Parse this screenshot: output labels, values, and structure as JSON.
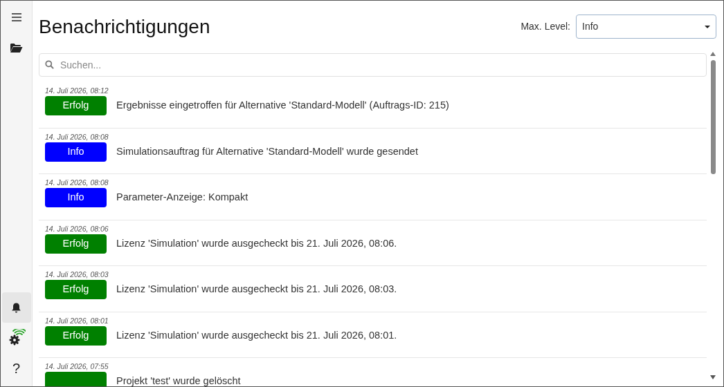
{
  "sidebar": {
    "items": [
      {
        "kind": "menu",
        "selected": false
      },
      {
        "kind": "folder",
        "selected": false
      }
    ],
    "bottom_items": [
      {
        "kind": "bell",
        "selected": true
      },
      {
        "kind": "settings-connected",
        "selected": false
      },
      {
        "kind": "help",
        "selected": false,
        "label": "?"
      }
    ]
  },
  "title": "Benachrichtigungen",
  "filter": {
    "label": "Max. Level:",
    "value": "Info"
  },
  "search": {
    "placeholder": "Suchen..."
  },
  "notifications": [
    {
      "time": "14. Juli 2026, 08:12",
      "kind": "success",
      "badge": "Erfolg",
      "message": "Ergebnisse eingetroffen für Alternative 'Standard-Modell' (Auftrags-ID: 215)"
    },
    {
      "time": "14. Juli 2026, 08:08",
      "kind": "info",
      "badge": "Info",
      "message": "Simulationsauftrag für Alternative 'Standard-Modell' wurde gesendet"
    },
    {
      "time": "14. Juli 2026, 08:08",
      "kind": "info",
      "badge": "Info",
      "message": "Parameter-Anzeige: Kompakt"
    },
    {
      "time": "14. Juli 2026, 08:06",
      "kind": "success",
      "badge": "Erfolg",
      "message": "Lizenz 'Simulation' wurde ausgecheckt bis 21. Juli 2026, 08:06."
    },
    {
      "time": "14. Juli 2026, 08:03",
      "kind": "success",
      "badge": "Erfolg",
      "message": "Lizenz 'Simulation' wurde ausgecheckt bis 21. Juli 2026, 08:03."
    },
    {
      "time": "14. Juli 2026, 08:01",
      "kind": "success",
      "badge": "Erfolg",
      "message": "Lizenz 'Simulation' wurde ausgecheckt bis 21. Juli 2026, 08:01."
    },
    {
      "time": "14. Juli 2026, 07:55",
      "kind": "success",
      "message": "Projekt 'test' wurde gelöscht"
    }
  ]
}
